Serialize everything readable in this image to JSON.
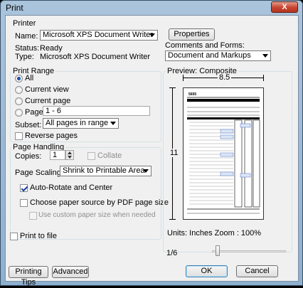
{
  "window": {
    "title": "Print",
    "close_label": "X"
  },
  "printer": {
    "group_label": "Printer",
    "name_label": "Name:",
    "name_value": "Microsoft XPS Document Writer",
    "properties_label": "Properties",
    "status_label": "Status:",
    "status_value": "Ready",
    "type_label": "Type:",
    "type_value": "Microsoft XPS Document Writer",
    "comments_label": "Comments and Forms:",
    "comments_value": "Document and Markups"
  },
  "print_range": {
    "group_label": "Print Range",
    "all_label": "All",
    "current_view_label": "Current view",
    "current_page_label": "Current page",
    "pages_label": "Pages",
    "pages_value": "1 - 6",
    "subset_label": "Subset:",
    "subset_value": "All pages in range",
    "reverse_label": "Reverse pages",
    "selected": "all"
  },
  "page_handling": {
    "group_label": "Page Handling",
    "copies_label": "Copies:",
    "copies_value": "1",
    "collate_label": "Collate",
    "scaling_label": "Page Scaling:",
    "scaling_value": "Shrink to Printable Area",
    "auto_rotate_label": "Auto-Rotate and Center",
    "auto_rotate_checked": true,
    "paper_source_label": "Choose paper source by PDF page size",
    "custom_paper_label": "Use custom paper size when needed"
  },
  "print_to_file_label": "Print to file",
  "preview": {
    "title": "Preview: Composite",
    "width_label": "8.5",
    "height_label": "11",
    "units_label": "Units: Inches Zoom : 100%",
    "page_indicator": "1/6",
    "form_number": "5695"
  },
  "buttons": {
    "printing_tips": "Printing Tips",
    "advanced": "Advanced",
    "ok": "OK",
    "cancel": "Cancel"
  }
}
